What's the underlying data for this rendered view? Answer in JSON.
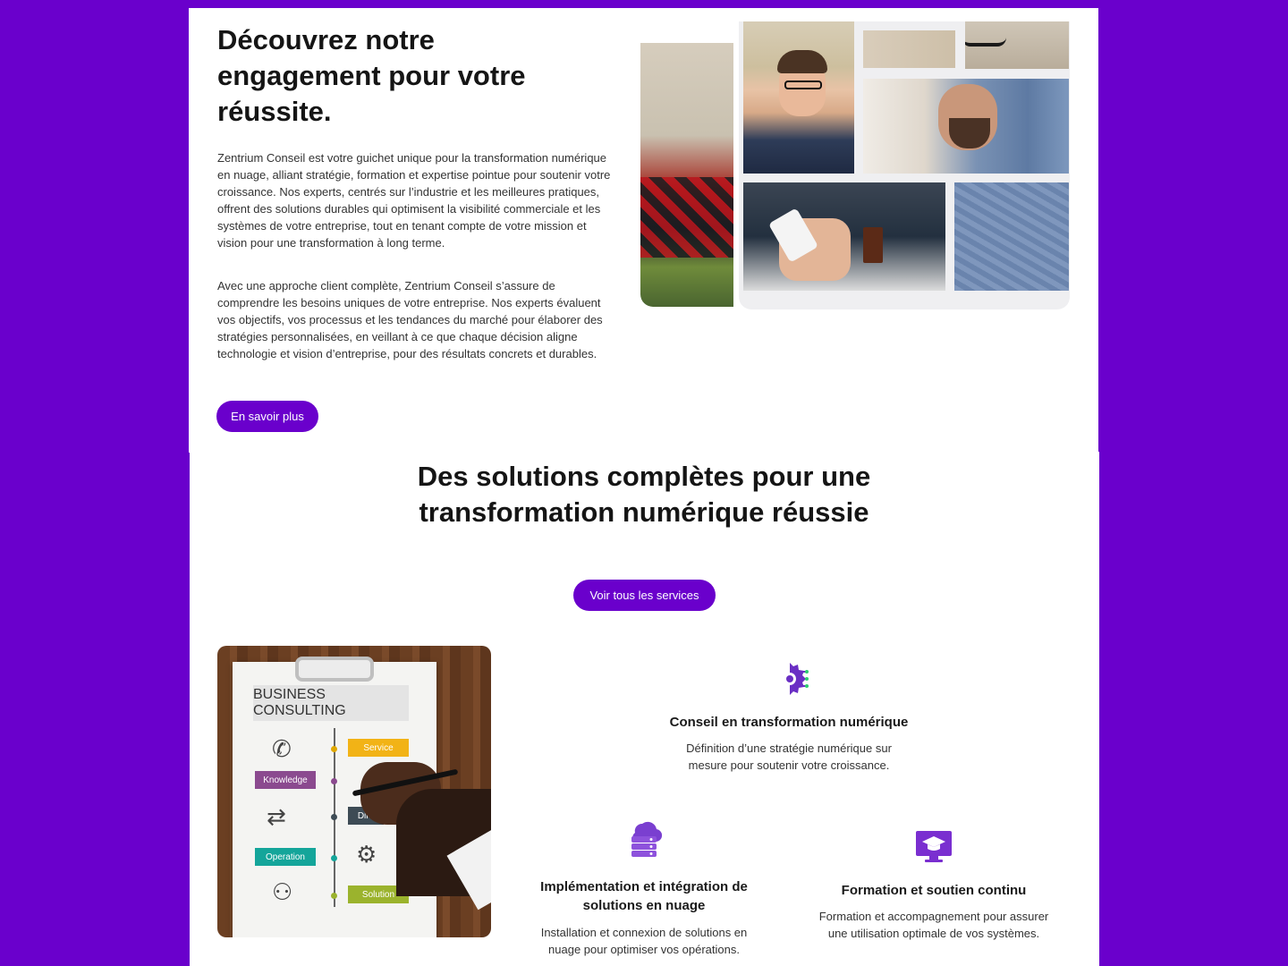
{
  "about": {
    "title": "Découvrez notre engagement pour votre réussite.",
    "paragraph_1": "Zentrium Conseil est votre guichet unique pour la transformation numérique en nuage, alliant stratégie, formation et expertise pointue pour soutenir votre croissance. Nos experts, centrés sur l’industrie et les meilleures pratiques, offrent des solutions durables qui optimisent la visibilité commerciale et les systèmes de votre entreprise, tout en tenant compte de votre mission et vision pour une transformation à long terme.",
    "paragraph_2": "Avec une approche client complète, Zentrium Conseil s’assure de comprendre les besoins uniques de votre entreprise. Nos experts évaluent vos objectifs, vos processus et les tendances du marché pour élaborer des stratégies personnalisées, en veillant à ce que chaque décision aligne technologie et vision d’entreprise, pour des résultats concrets et durables.",
    "cta_label": "En savoir plus"
  },
  "services": {
    "title": "Des solutions complètes pour une transformation numérique réussie",
    "cta_label": "Voir tous les services",
    "image": {
      "heading": "BUSINESS CONSULTING",
      "tags": [
        "Service",
        "Knowledge",
        "Dire",
        "Operation",
        "Solution"
      ]
    },
    "items": [
      {
        "icon": "gear-circuit-icon",
        "title": "Conseil en transformation numérique",
        "description": "Définition d’une stratégie numérique sur mesure pour soutenir votre croissance."
      },
      {
        "icon": "cloud-server-icon",
        "title": "Implémentation et intégration de solutions en nuage",
        "description": "Installation et connexion de solutions en nuage pour optimiser vos opérations."
      },
      {
        "icon": "graduation-monitor-icon",
        "title": "Formation et soutien continu",
        "description": "Formation et accompagnement pour assurer une utilisation optimale de vos systèmes."
      }
    ]
  },
  "colors": {
    "accent": "#6a00cc",
    "background": "#ffffff",
    "text": "#151515"
  }
}
